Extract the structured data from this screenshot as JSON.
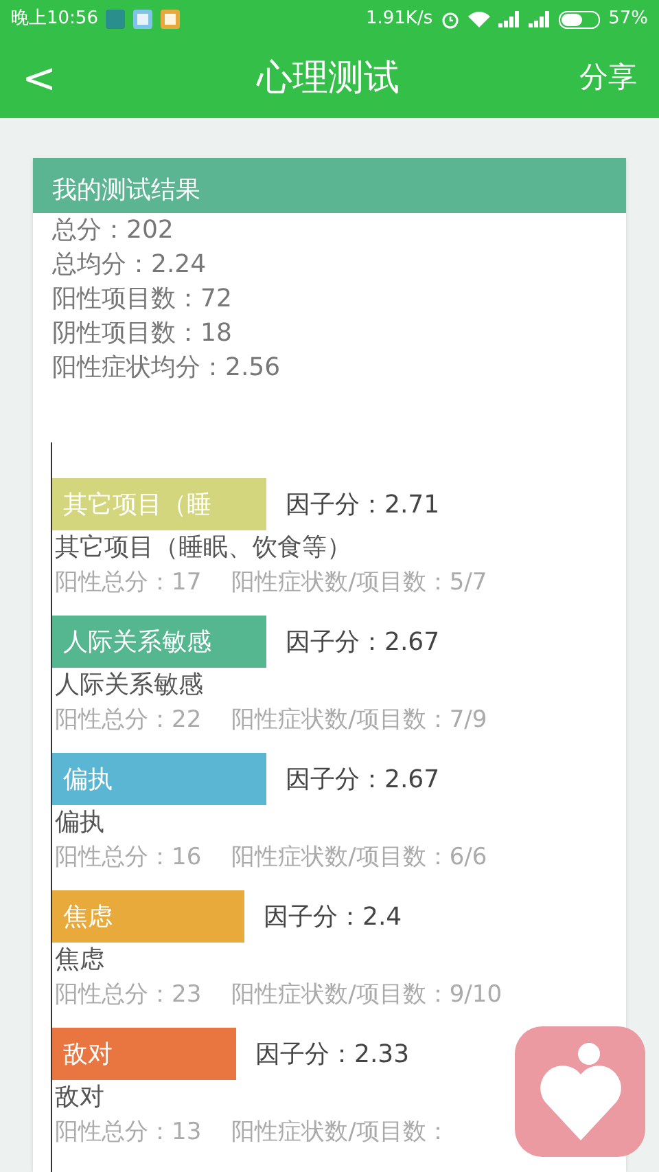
{
  "status_bar": {
    "time": "晚上10:56",
    "speed": "1.91K/s",
    "battery": "57%"
  },
  "header": {
    "back": "<",
    "title": "心理测试",
    "share": "分享"
  },
  "result": {
    "title": "我的测试结果",
    "summary": [
      "总分：202",
      "总均分：2.24",
      "阳性项目数：72",
      "阴性项目数：18",
      "阳性症状均分：2.56"
    ],
    "factors": [
      {
        "bar_label": "其它项目（睡",
        "color": "#d3d67c",
        "score": "因子分：2.71",
        "name": "其它项目（睡眠、饮食等）",
        "total": "阳性总分：17",
        "ratio": "阳性症状数/项目数：5/7"
      },
      {
        "bar_label": "人际关系敏感",
        "color": "#54b78f",
        "score": "因子分：2.67",
        "name": "人际关系敏感",
        "total": "阳性总分：22",
        "ratio": "阳性症状数/项目数：7/9"
      },
      {
        "bar_label": "偏执",
        "color": "#5ab6d2",
        "score": "因子分：2.67",
        "name": "偏执",
        "total": "阳性总分：16",
        "ratio": "阳性症状数/项目数：6/6"
      },
      {
        "bar_label": "焦虑",
        "color": "#e8aa3a",
        "score": "因子分：2.4",
        "name": "焦虑",
        "total": "阳性总分：23",
        "ratio": "阳性症状数/项目数：9/10"
      },
      {
        "bar_label": "敌对",
        "color": "#e97540",
        "score": "因子分：2.33",
        "name": "敌对",
        "total": "阳性总分：13",
        "ratio": "阳性症状数/项目数："
      }
    ]
  }
}
